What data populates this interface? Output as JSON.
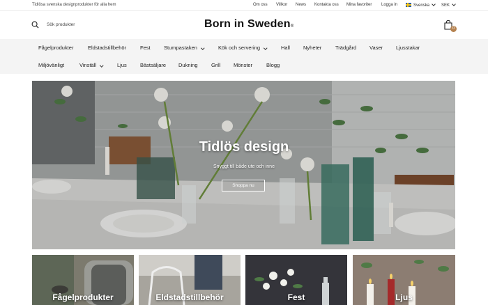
{
  "topbar": {
    "tagline": "Tidlösa svenska designprodukter för alla hem",
    "links": [
      "Om oss",
      "Villkor",
      "News",
      "Kontakta oss",
      "Mina favoriter",
      "Logga in"
    ],
    "language": "Svenska",
    "currency": "SEK"
  },
  "header": {
    "search_placeholder": "Sök produkter",
    "logo_text": "Born in Sweden",
    "logo_mark": "®",
    "cart_count": "0"
  },
  "nav": {
    "row1": [
      {
        "label": "Fågelprodukter",
        "dropdown": false
      },
      {
        "label": "Eldstadstillbehör",
        "dropdown": false
      },
      {
        "label": "Fest",
        "dropdown": false
      },
      {
        "label": "Stumpastaken",
        "dropdown": true
      },
      {
        "label": "Kök och servering",
        "dropdown": true
      },
      {
        "label": "Hall",
        "dropdown": false
      },
      {
        "label": "Nyheter",
        "dropdown": false
      },
      {
        "label": "Trädgård",
        "dropdown": false
      },
      {
        "label": "Vaser",
        "dropdown": false
      },
      {
        "label": "Ljusstakar",
        "dropdown": false
      }
    ],
    "row2": [
      {
        "label": "Miljövänligt",
        "dropdown": false
      },
      {
        "label": "Vinställ",
        "dropdown": true
      },
      {
        "label": "Ljus",
        "dropdown": false
      },
      {
        "label": "Bästsäljare",
        "dropdown": false
      },
      {
        "label": "Dukning",
        "dropdown": false
      },
      {
        "label": "Grill",
        "dropdown": false
      },
      {
        "label": "Mönster",
        "dropdown": false
      },
      {
        "label": "Blogg",
        "dropdown": false
      }
    ]
  },
  "hero": {
    "title": "Tidlös design",
    "subtitle": "Snyggt till både ute och inne",
    "button": "Shoppa nu"
  },
  "categories": [
    "Fågelprodukter",
    "Eldstadstillbehör",
    "Fest",
    "Ljus"
  ],
  "colors": {
    "accent": "#b5824f",
    "nav_bg": "#f4f4f4"
  }
}
